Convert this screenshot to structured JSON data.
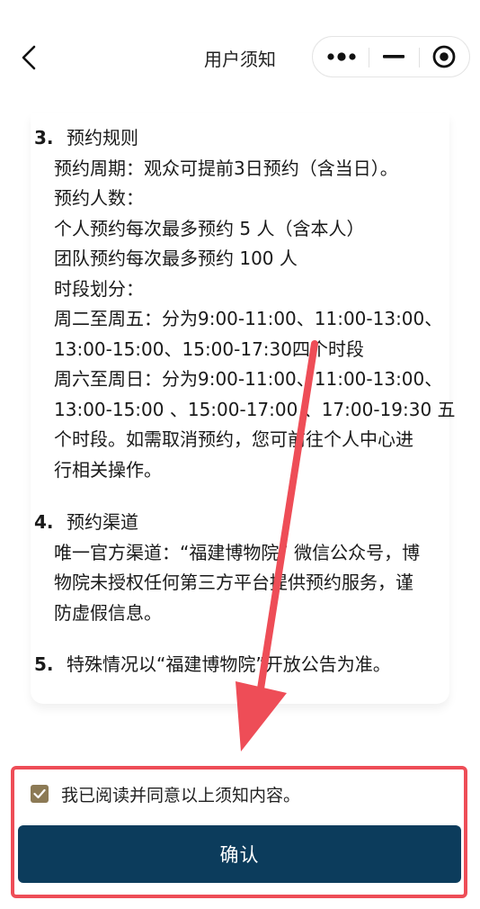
{
  "nav": {
    "title": "用户须知",
    "back_icon": "chevron-left-icon",
    "menu_icon": "more-dots-icon",
    "minimize_icon": "minus-icon",
    "close_icon": "target-circle-icon"
  },
  "sections": [
    {
      "number": "3.",
      "title": "预约规则",
      "lines": [
        "预约周期：观众可提前3日预约（含当日）。",
        "预约人数：",
        "个人预约每次最多预约 5 人（含本人）",
        "团队预约每次最多预约 100 人",
        "时段划分：",
        "周二至周五：分为9:00-11:00、11:00-13:00、",
        "13:00-15:00、15:00-17:30四个时段",
        "周六至周日：分为9:00-11:00、11:00-13:00、",
        "13:00-15:00 、15:00-17:00 、17:00-19:30 五",
        "个时段。如需取消预约，您可前往个人中心进",
        "行相关操作。"
      ]
    },
    {
      "number": "4.",
      "title": "预约渠道",
      "lines": [
        "唯一官方渠道：“福建博物院” 微信公众号，博",
        "物院未授权任何第三方平台提供预约服务，谨",
        "防虚假信息。"
      ]
    },
    {
      "number": "5.",
      "title": "特殊情况以“福建博物院”开放公告为准。",
      "lines": []
    }
  ],
  "agreement": {
    "checked": true,
    "text": "我已阅读并同意以上须知内容。"
  },
  "confirm": {
    "label": "确认"
  },
  "colors": {
    "primary_button": "#0c3c5c",
    "checkbox": "#8c7a55",
    "annotation": "#ee4d57"
  }
}
